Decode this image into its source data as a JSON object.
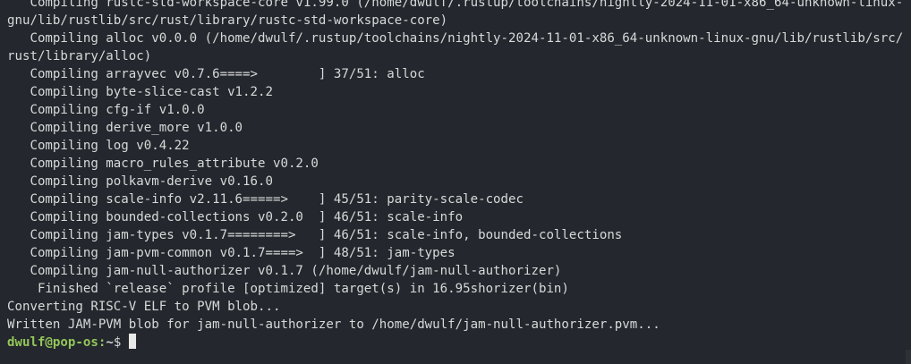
{
  "terminal": {
    "lines": [
      "   Compiling rustc-std-workspace-core v1.99.0 (/home/dwulf/.rustup/toolchains/nightly-2024-11-01-x86_64-unknown-linux-",
      "gnu/lib/rustlib/src/rust/library/rustc-std-workspace-core)",
      "   Compiling alloc v0.0.0 (/home/dwulf/.rustup/toolchains/nightly-2024-11-01-x86_64-unknown-linux-gnu/lib/rustlib/src/",
      "rust/library/alloc)",
      "   Compiling arrayvec v0.7.6====>        ] 37/51: alloc",
      "   Compiling byte-slice-cast v1.2.2",
      "   Compiling cfg-if v1.0.0",
      "   Compiling derive_more v1.0.0",
      "   Compiling log v0.4.22",
      "   Compiling macro_rules_attribute v0.2.0",
      "   Compiling polkavm-derive v0.16.0",
      "   Compiling scale-info v2.11.6=====>    ] 45/51: parity-scale-codec",
      "   Compiling bounded-collections v0.2.0  ] 46/51: scale-info",
      "   Compiling jam-types v0.1.7========>   ] 46/51: scale-info, bounded-collections",
      "   Compiling jam-pvm-common v0.1.7====>  ] 48/51: jam-types",
      "   Compiling jam-null-authorizer v0.1.7 (/home/dwulf/jam-null-authorizer)",
      "    Finished `release` profile [optimized] target(s) in 16.95shorizer(bin)",
      "Converting RISC-V ELF to PVM blob...",
      "Written JAM-PVM blob for jam-null-authorizer to /home/dwulf/jam-null-authorizer.pvm..."
    ],
    "prompt": {
      "user_host": "dwulf@pop-os",
      "separator": ":",
      "path": "~",
      "symbol": "$ "
    },
    "colors": {
      "background": "#24272d",
      "foreground": "#d7dad9",
      "prompt_user": "#94c65a"
    }
  }
}
